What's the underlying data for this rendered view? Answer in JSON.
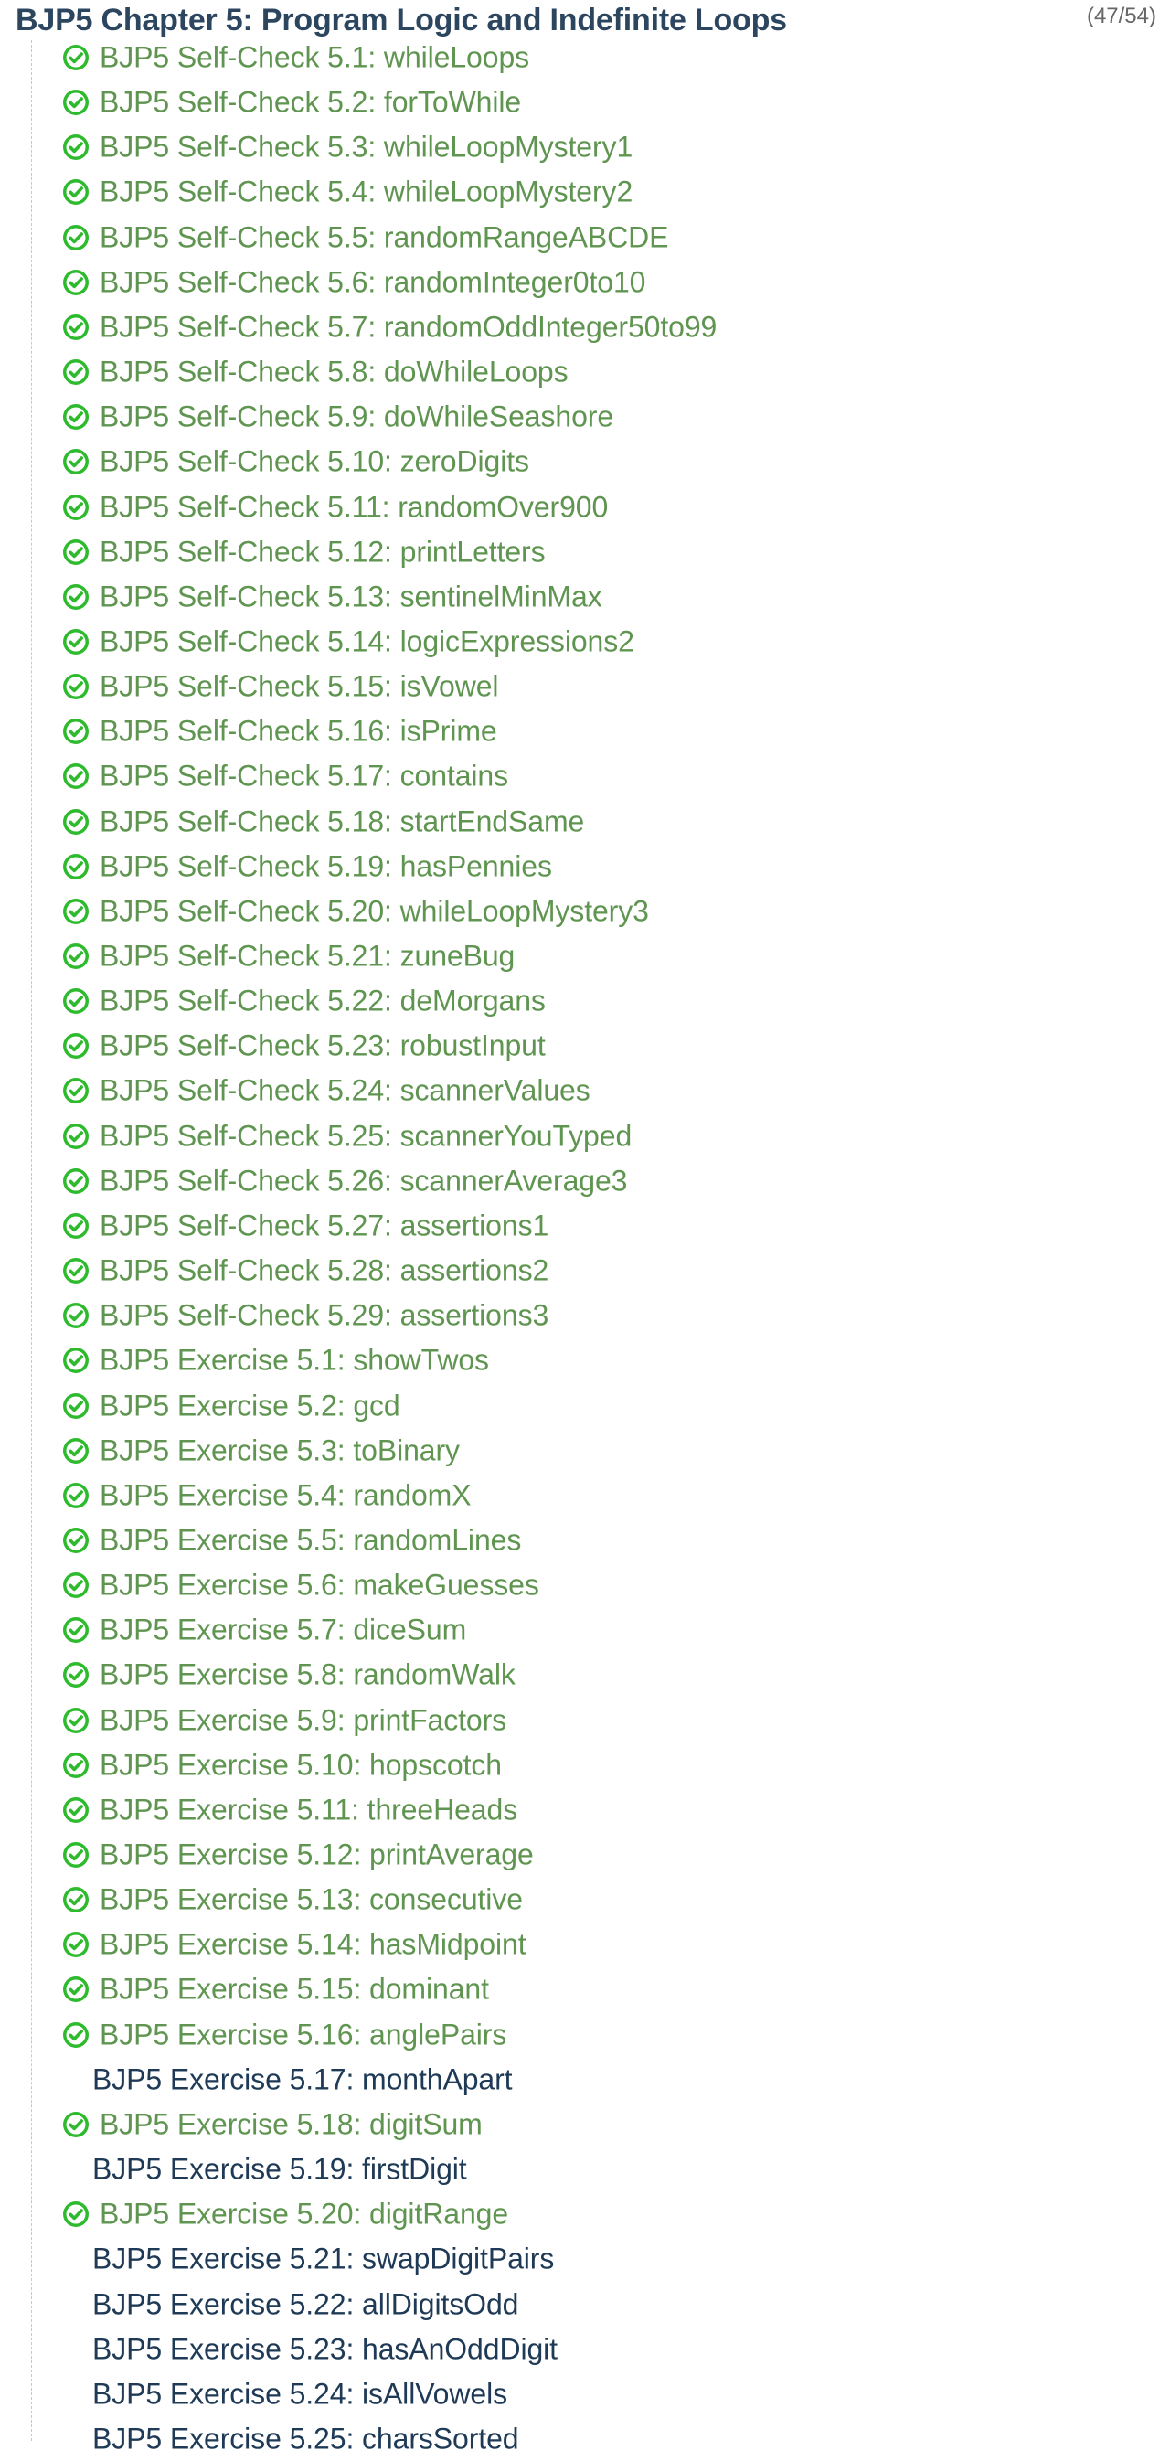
{
  "chapter": {
    "title": "BJP5 Chapter 5: Program Logic and Indefinite Loops",
    "progress": "(47/54)"
  },
  "colors": {
    "solved_text": "#5f9550",
    "unsolved_text": "#1f3a56",
    "check_icon": "#2dbb2d",
    "title": "#2c4660"
  },
  "icons": {
    "solved": "check-circle-icon"
  },
  "problems": [
    {
      "label": "BJP5 Self-Check 5.1: whileLoops",
      "solved": true
    },
    {
      "label": "BJP5 Self-Check 5.2: forToWhile",
      "solved": true
    },
    {
      "label": "BJP5 Self-Check 5.3: whileLoopMystery1",
      "solved": true
    },
    {
      "label": "BJP5 Self-Check 5.4: whileLoopMystery2",
      "solved": true
    },
    {
      "label": "BJP5 Self-Check 5.5: randomRangeABCDE",
      "solved": true
    },
    {
      "label": "BJP5 Self-Check 5.6: randomInteger0to10",
      "solved": true
    },
    {
      "label": "BJP5 Self-Check 5.7: randomOddInteger50to99",
      "solved": true
    },
    {
      "label": "BJP5 Self-Check 5.8: doWhileLoops",
      "solved": true
    },
    {
      "label": "BJP5 Self-Check 5.9: doWhileSeashore",
      "solved": true
    },
    {
      "label": "BJP5 Self-Check 5.10: zeroDigits",
      "solved": true
    },
    {
      "label": "BJP5 Self-Check 5.11: randomOver900",
      "solved": true
    },
    {
      "label": "BJP5 Self-Check 5.12: printLetters",
      "solved": true
    },
    {
      "label": "BJP5 Self-Check 5.13: sentinelMinMax",
      "solved": true
    },
    {
      "label": "BJP5 Self-Check 5.14: logicExpressions2",
      "solved": true
    },
    {
      "label": "BJP5 Self-Check 5.15: isVowel",
      "solved": true
    },
    {
      "label": "BJP5 Self-Check 5.16: isPrime",
      "solved": true
    },
    {
      "label": "BJP5 Self-Check 5.17: contains",
      "solved": true
    },
    {
      "label": "BJP5 Self-Check 5.18: startEndSame",
      "solved": true
    },
    {
      "label": "BJP5 Self-Check 5.19: hasPennies",
      "solved": true
    },
    {
      "label": "BJP5 Self-Check 5.20: whileLoopMystery3",
      "solved": true
    },
    {
      "label": "BJP5 Self-Check 5.21: zuneBug",
      "solved": true
    },
    {
      "label": "BJP5 Self-Check 5.22: deMorgans",
      "solved": true
    },
    {
      "label": "BJP5 Self-Check 5.23: robustInput",
      "solved": true
    },
    {
      "label": "BJP5 Self-Check 5.24: scannerValues",
      "solved": true
    },
    {
      "label": "BJP5 Self-Check 5.25: scannerYouTyped",
      "solved": true
    },
    {
      "label": "BJP5 Self-Check 5.26: scannerAverage3",
      "solved": true
    },
    {
      "label": "BJP5 Self-Check 5.27: assertions1",
      "solved": true
    },
    {
      "label": "BJP5 Self-Check 5.28: assertions2",
      "solved": true
    },
    {
      "label": "BJP5 Self-Check 5.29: assertions3",
      "solved": true
    },
    {
      "label": "BJP5 Exercise 5.1: showTwos",
      "solved": true
    },
    {
      "label": "BJP5 Exercise 5.2: gcd",
      "solved": true
    },
    {
      "label": "BJP5 Exercise 5.3: toBinary",
      "solved": true
    },
    {
      "label": "BJP5 Exercise 5.4: randomX",
      "solved": true
    },
    {
      "label": "BJP5 Exercise 5.5: randomLines",
      "solved": true
    },
    {
      "label": "BJP5 Exercise 5.6: makeGuesses",
      "solved": true
    },
    {
      "label": "BJP5 Exercise 5.7: diceSum",
      "solved": true
    },
    {
      "label": "BJP5 Exercise 5.8: randomWalk",
      "solved": true
    },
    {
      "label": "BJP5 Exercise 5.9: printFactors",
      "solved": true
    },
    {
      "label": "BJP5 Exercise 5.10: hopscotch",
      "solved": true
    },
    {
      "label": "BJP5 Exercise 5.11: threeHeads",
      "solved": true
    },
    {
      "label": "BJP5 Exercise 5.12: printAverage",
      "solved": true
    },
    {
      "label": "BJP5 Exercise 5.13: consecutive",
      "solved": true
    },
    {
      "label": "BJP5 Exercise 5.14: hasMidpoint",
      "solved": true
    },
    {
      "label": "BJP5 Exercise 5.15: dominant",
      "solved": true
    },
    {
      "label": "BJP5 Exercise 5.16: anglePairs",
      "solved": true
    },
    {
      "label": "BJP5 Exercise 5.17: monthApart",
      "solved": false
    },
    {
      "label": "BJP5 Exercise 5.18: digitSum",
      "solved": true
    },
    {
      "label": "BJP5 Exercise 5.19: firstDigit",
      "solved": false
    },
    {
      "label": "BJP5 Exercise 5.20: digitRange",
      "solved": true
    },
    {
      "label": "BJP5 Exercise 5.21: swapDigitPairs",
      "solved": false
    },
    {
      "label": "BJP5 Exercise 5.22: allDigitsOdd",
      "solved": false
    },
    {
      "label": "BJP5 Exercise 5.23: hasAnOddDigit",
      "solved": false
    },
    {
      "label": "BJP5 Exercise 5.24: isAllVowels",
      "solved": false
    },
    {
      "label": "BJP5 Exercise 5.25: charsSorted",
      "solved": false
    }
  ]
}
